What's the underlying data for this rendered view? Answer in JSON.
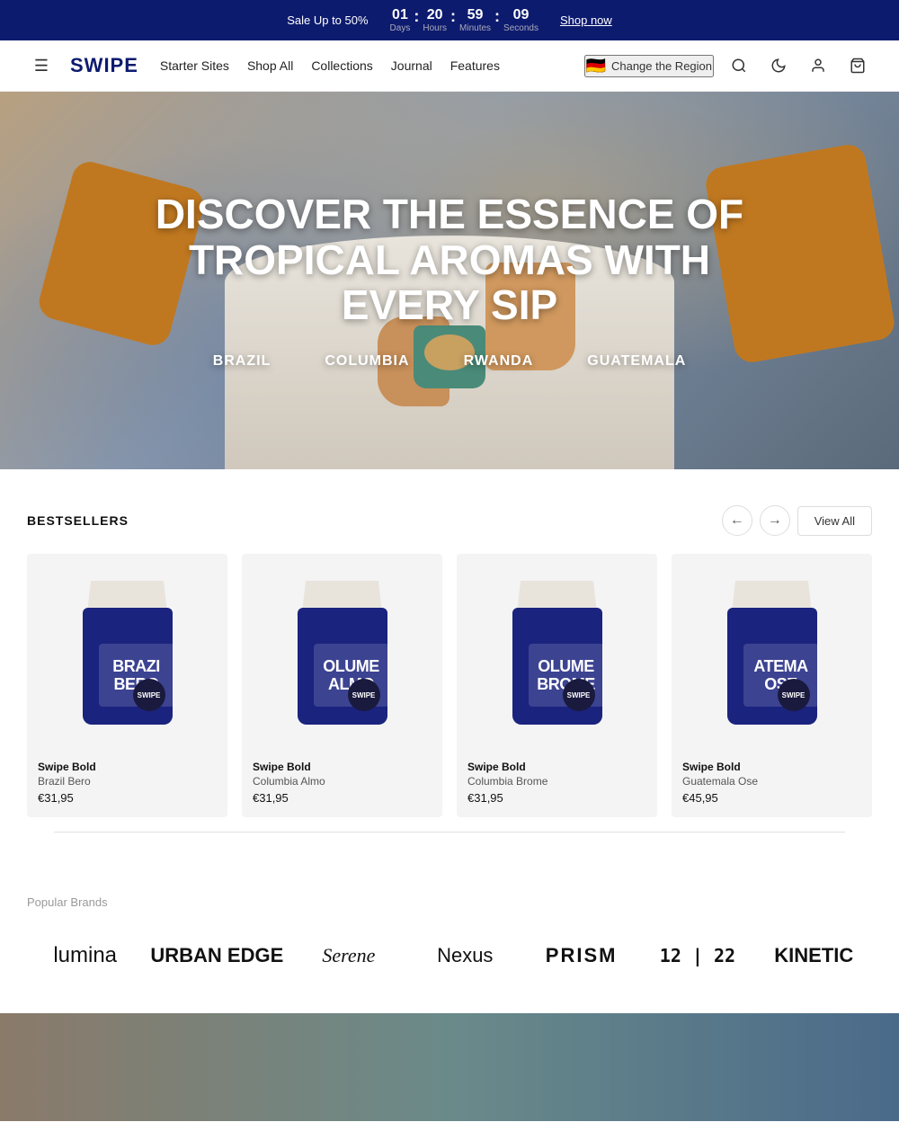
{
  "announcement": {
    "sale_text": "Sale Up to 50%",
    "countdown": {
      "days_num": "01",
      "days_lbl": "Days",
      "hours_num": "20",
      "hours_lbl": "Hours",
      "minutes_num": "59",
      "minutes_lbl": "Minutes",
      "seconds_num": "09",
      "seconds_lbl": "Seconds"
    },
    "shop_now": "Shop now"
  },
  "header": {
    "logo": "SWIPE",
    "nav": [
      {
        "label": "Starter Sites"
      },
      {
        "label": "Shop All"
      },
      {
        "label": "Collections"
      },
      {
        "label": "Journal"
      },
      {
        "label": "Features"
      }
    ],
    "region": "Change the Region",
    "flag": "🇩🇪"
  },
  "hero": {
    "title": "DISCOVER THE ESSENCE OF TROPICAL AROMAS WITH EVERY SIP",
    "links": [
      {
        "label": "BRAZIL"
      },
      {
        "label": "COLUMBIA"
      },
      {
        "label": "RWANDA"
      },
      {
        "label": "GUATEMALA"
      }
    ]
  },
  "bestsellers": {
    "section_title": "BESTSELLERS",
    "view_all": "View All",
    "products": [
      {
        "brand": "Swipe Bold",
        "name": "Brazil Bero",
        "price": "€31,95",
        "bag_lines": [
          "BRAZI",
          "BERO"
        ],
        "circle": "SWIPE"
      },
      {
        "brand": "Swipe Bold",
        "name": "Columbia Almo",
        "price": "€31,95",
        "bag_lines": [
          "OLUME",
          "ALMO"
        ],
        "circle": "SWIPE"
      },
      {
        "brand": "Swipe Bold",
        "name": "Columbia Brome",
        "price": "€31,95",
        "bag_lines": [
          "OLUME",
          "BROME"
        ],
        "circle": "SWIPE"
      },
      {
        "brand": "Swipe Bold",
        "name": "Guatemala Ose",
        "price": "€45,95",
        "bag_lines": [
          "ATEMA",
          "OSE"
        ],
        "circle": "SWIPE"
      }
    ]
  },
  "brands": {
    "label": "Popular Brands",
    "items": [
      {
        "name": "lumina",
        "style": "light"
      },
      {
        "name": "URBAN EDGE",
        "style": "bold"
      },
      {
        "name": "Serene",
        "style": "italic-serif"
      },
      {
        "name": "Nexus",
        "style": "normal"
      },
      {
        "name": "PRISM",
        "style": "condensed"
      },
      {
        "name": "12 | 22",
        "style": "mono"
      },
      {
        "name": "KINETIC",
        "style": "bold"
      }
    ]
  }
}
